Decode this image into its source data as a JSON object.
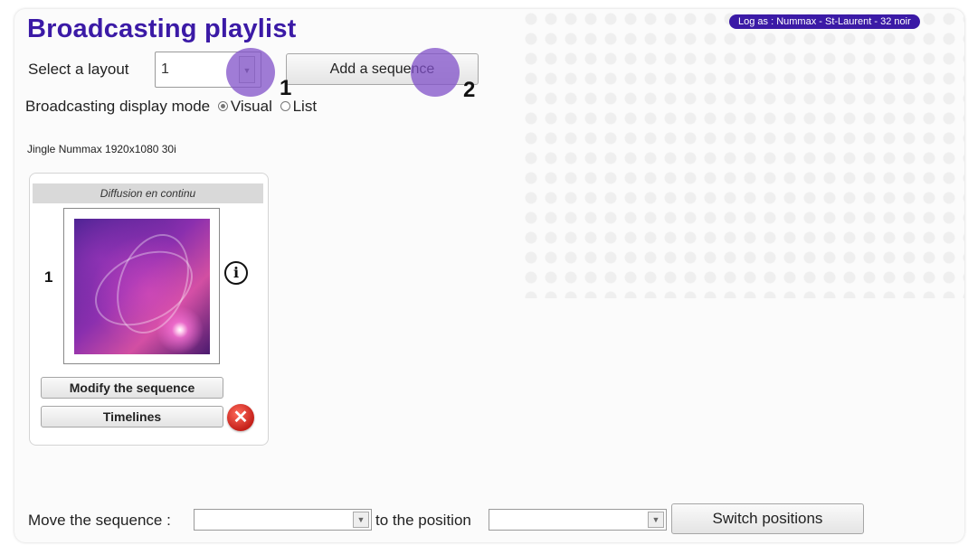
{
  "header": {
    "title": "Broadcasting playlist",
    "login": "Log as : Nummax - St-Laurent - 32 noir"
  },
  "layout": {
    "label": "Select a layout",
    "value": "1",
    "add_sequence": "Add a sequence"
  },
  "markers": [
    "1",
    "2"
  ],
  "display_mode": {
    "label": "Broadcasting display mode",
    "options": [
      "Visual",
      "List"
    ],
    "selected": "Visual"
  },
  "jingle": "Jingle Nummax 1920x1080 30i",
  "sequence": {
    "header": "Diffusion en continu",
    "number": "1",
    "modify": "Modify the sequence",
    "timelines": "Timelines"
  },
  "footer": {
    "move_label": "Move the sequence :",
    "position_label": "to the position",
    "switch": "Switch positions"
  },
  "icons": [
    "dropdown-arrow-icon",
    "info-icon",
    "delete-icon",
    "radio-icon"
  ],
  "colors": {
    "accent": "#3b1aa6",
    "marker": "#8050c8",
    "delete": "#d12a20"
  }
}
